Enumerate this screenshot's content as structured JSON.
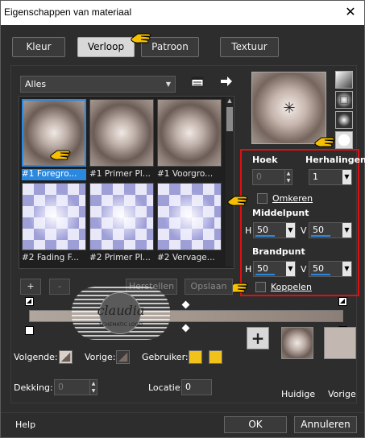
{
  "window": {
    "title": "Eigenschappen van materiaal",
    "close": "✕"
  },
  "tabs": [
    {
      "label": "Kleur",
      "active": false
    },
    {
      "label": "Verloop",
      "active": true
    },
    {
      "label": "Patroon",
      "active": false
    },
    {
      "label": "Textuur",
      "active": false
    }
  ],
  "library": {
    "category": "Alles"
  },
  "thumbnails": [
    {
      "caption": "#1 Foregro...",
      "selected": true
    },
    {
      "caption": "#1 Primer Pl..."
    },
    {
      "caption": "#1 Voorgro..."
    },
    {
      "caption": "#2 Fading F..."
    },
    {
      "caption": "#2 Primer Pl..."
    },
    {
      "caption": "#2 Vervage..."
    }
  ],
  "settings": {
    "hoek_label": "Hoek",
    "hoek_value": "0",
    "herhalingen_label": "Herhalingen",
    "herhalingen_value": "1",
    "omkeren_label": "Omkeren",
    "middelpunt_label": "Middelpunt",
    "middelpunt_h_label": "H",
    "middelpunt_h": "50",
    "middelpunt_v_label": "V",
    "middelpunt_v": "50",
    "brandpunt_label": "Brandpunt",
    "brandpunt_h_label": "H",
    "brandpunt_h": "50",
    "brandpunt_v_label": "V",
    "brandpunt_v": "50",
    "koppelen_label": "Koppelen"
  },
  "editor": {
    "add": "+",
    "remove": "-",
    "herstellen": "Herstellen",
    "opslaan": "Opslaan"
  },
  "bottom": {
    "volgende_label": "Volgende:",
    "vorige_label": "Vorige:",
    "gebruiker_label": "Gebruiker:",
    "dekking_label": "Dekking:",
    "dekking_value": "0",
    "locatie_label": "Locatie:",
    "locatie_value": "0",
    "huidige_label": "Huidige",
    "vorige_preview_label": "Vorige",
    "help": "Help",
    "ok": "OK",
    "annuleren": "Annuleren"
  },
  "watermark": {
    "text": "claudia",
    "sub": "SCHEMATIC LOGO"
  },
  "colors": {
    "gebruiker_1": "#f1c21b",
    "gebruiker_2": "#f1c21b",
    "accent": "#2a88e0",
    "highlight": "#dd1111",
    "vorige_swatch": "#c2b8b1"
  }
}
